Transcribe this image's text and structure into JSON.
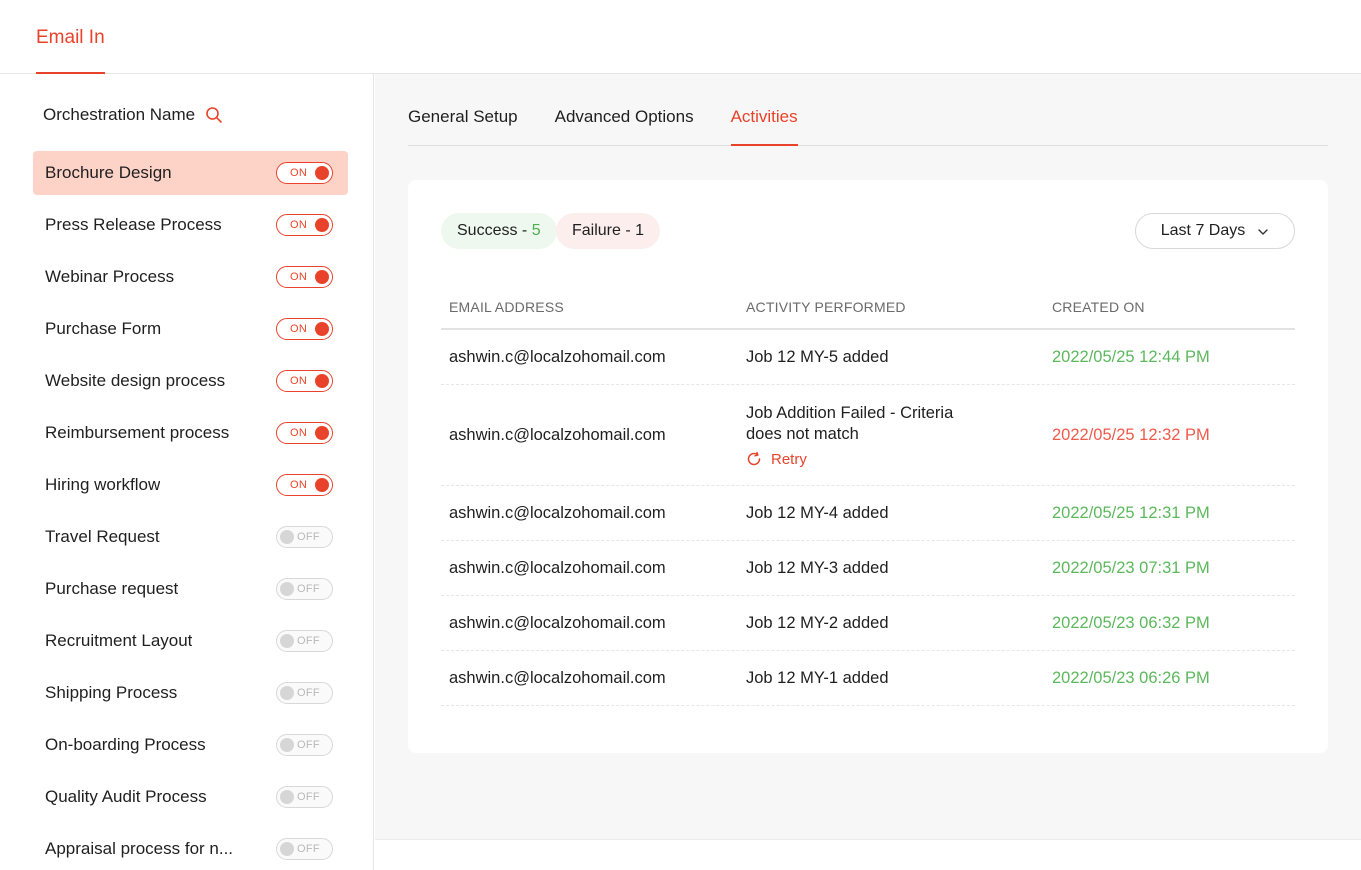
{
  "top_tab": "Email In",
  "sidebar": {
    "header": "Orchestration Name",
    "items": [
      {
        "name": "Brochure Design",
        "state": "ON",
        "active": true
      },
      {
        "name": "Press Release Process",
        "state": "ON"
      },
      {
        "name": "Webinar Process",
        "state": "ON"
      },
      {
        "name": "Purchase Form",
        "state": "ON"
      },
      {
        "name": "Website design process",
        "state": "ON"
      },
      {
        "name": "Reimbursement process",
        "state": "ON"
      },
      {
        "name": "Hiring workflow",
        "state": "ON"
      },
      {
        "name": "Travel Request",
        "state": "OFF"
      },
      {
        "name": "Purchase request",
        "state": "OFF"
      },
      {
        "name": "Recruitment Layout",
        "state": "OFF"
      },
      {
        "name": "Shipping Process",
        "state": "OFF"
      },
      {
        "name": "On-boarding Process",
        "state": "OFF"
      },
      {
        "name": "Quality Audit Process",
        "state": "OFF"
      },
      {
        "name": "Appraisal process for n...",
        "state": "OFF"
      }
    ]
  },
  "tabs": [
    "General Setup",
    "Advanced Options",
    "Activities"
  ],
  "active_tab": "Activities",
  "summary": {
    "success_label": "Success - ",
    "success_count": "5",
    "failure_label": "Failure - 1"
  },
  "date_filter": "Last 7 Days",
  "table": {
    "headers": [
      "EMAIL ADDRESS",
      "ACTIVITY PERFORMED",
      "CREATED ON"
    ],
    "rows": [
      {
        "email": "ashwin.c@localzohomail.com",
        "activity": "Job 12 MY-5 added",
        "created": "2022/05/25 12:44 PM",
        "status": "success"
      },
      {
        "email": "ashwin.c@localzohomail.com",
        "activity": "Job Addition Failed - Criteria does not match",
        "created": "2022/05/25 12:32 PM",
        "status": "failure",
        "action": "Retry"
      },
      {
        "email": "ashwin.c@localzohomail.com",
        "activity": "Job 12 MY-4 added",
        "created": "2022/05/25 12:31 PM",
        "status": "success"
      },
      {
        "email": "ashwin.c@localzohomail.com",
        "activity": "Job 12 MY-3 added",
        "created": "2022/05/23 07:31 PM",
        "status": "success"
      },
      {
        "email": "ashwin.c@localzohomail.com",
        "activity": "Job 12 MY-2 added",
        "created": "2022/05/23 06:32 PM",
        "status": "success"
      },
      {
        "email": "ashwin.c@localzohomail.com",
        "activity": "Job 12 MY-1 added",
        "created": "2022/05/23 06:26 PM",
        "status": "success"
      }
    ]
  },
  "colors": {
    "accent": "#e8432a",
    "success": "#5cb85c",
    "failure": "#ef5a4c"
  },
  "icons": {
    "search": "search-icon",
    "chevron": "chevron-down-icon",
    "retry": "retry-icon"
  }
}
